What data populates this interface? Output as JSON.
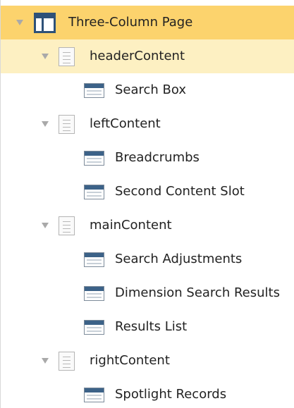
{
  "tree": {
    "root": {
      "label": "Three-Column Page",
      "icon": "page-layout-icon"
    },
    "sections": [
      {
        "label": "headerContent",
        "icon": "content-slot-icon",
        "selected": true,
        "children": [
          {
            "label": "Search Box",
            "icon": "cartridge-icon"
          }
        ]
      },
      {
        "label": "leftContent",
        "icon": "content-slot-icon",
        "children": [
          {
            "label": "Breadcrumbs",
            "icon": "cartridge-icon"
          },
          {
            "label": "Second Content Slot",
            "icon": "cartridge-icon"
          }
        ]
      },
      {
        "label": "mainContent",
        "icon": "content-slot-icon",
        "children": [
          {
            "label": "Search Adjustments",
            "icon": "cartridge-icon"
          },
          {
            "label": "Dimension Search Results",
            "icon": "cartridge-icon"
          },
          {
            "label": "Results List",
            "icon": "cartridge-icon"
          }
        ]
      },
      {
        "label": "rightContent",
        "icon": "content-slot-icon",
        "children": [
          {
            "label": "Spotlight Records",
            "icon": "cartridge-icon"
          }
        ]
      }
    ]
  },
  "colors": {
    "root_highlight": "#fcd36d",
    "selected_highlight": "#fdf0c2",
    "icon_blue": "#2e5178"
  }
}
